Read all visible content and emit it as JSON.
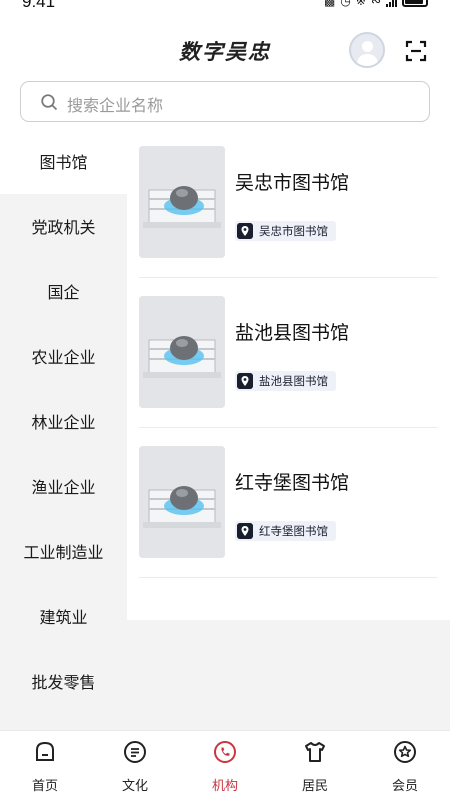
{
  "status_bar": {
    "time": "9:41"
  },
  "header": {
    "title": "数字吴忠"
  },
  "search": {
    "placeholder": "搜索企业名称"
  },
  "sidebar": {
    "items": [
      {
        "label": "图书馆",
        "active": true
      },
      {
        "label": "党政机关"
      },
      {
        "label": "国企"
      },
      {
        "label": "农业企业"
      },
      {
        "label": "林业企业"
      },
      {
        "label": "渔业企业"
      },
      {
        "label": "工业制造业"
      },
      {
        "label": "建筑业"
      },
      {
        "label": "批发零售"
      }
    ]
  },
  "cards": [
    {
      "name": "吴忠市图书馆",
      "location": "吴忠市图书馆"
    },
    {
      "name": "盐池县图书馆",
      "location": "盐池县图书馆"
    },
    {
      "name": "红寺堡图书馆",
      "location": "红寺堡图书馆"
    }
  ],
  "tabbar": {
    "tabs": [
      {
        "label": "首页",
        "icon": "home-icon"
      },
      {
        "label": "文化",
        "icon": "list-icon"
      },
      {
        "label": "机构",
        "icon": "phone-icon",
        "active": true
      },
      {
        "label": "居民",
        "icon": "shirt-icon"
      },
      {
        "label": "会员",
        "icon": "star-badge-icon"
      }
    ]
  },
  "colors": {
    "accent": "#c8363f",
    "sidebar_bg": "#f3f3f3",
    "badge_bg": "#eef1f8"
  }
}
